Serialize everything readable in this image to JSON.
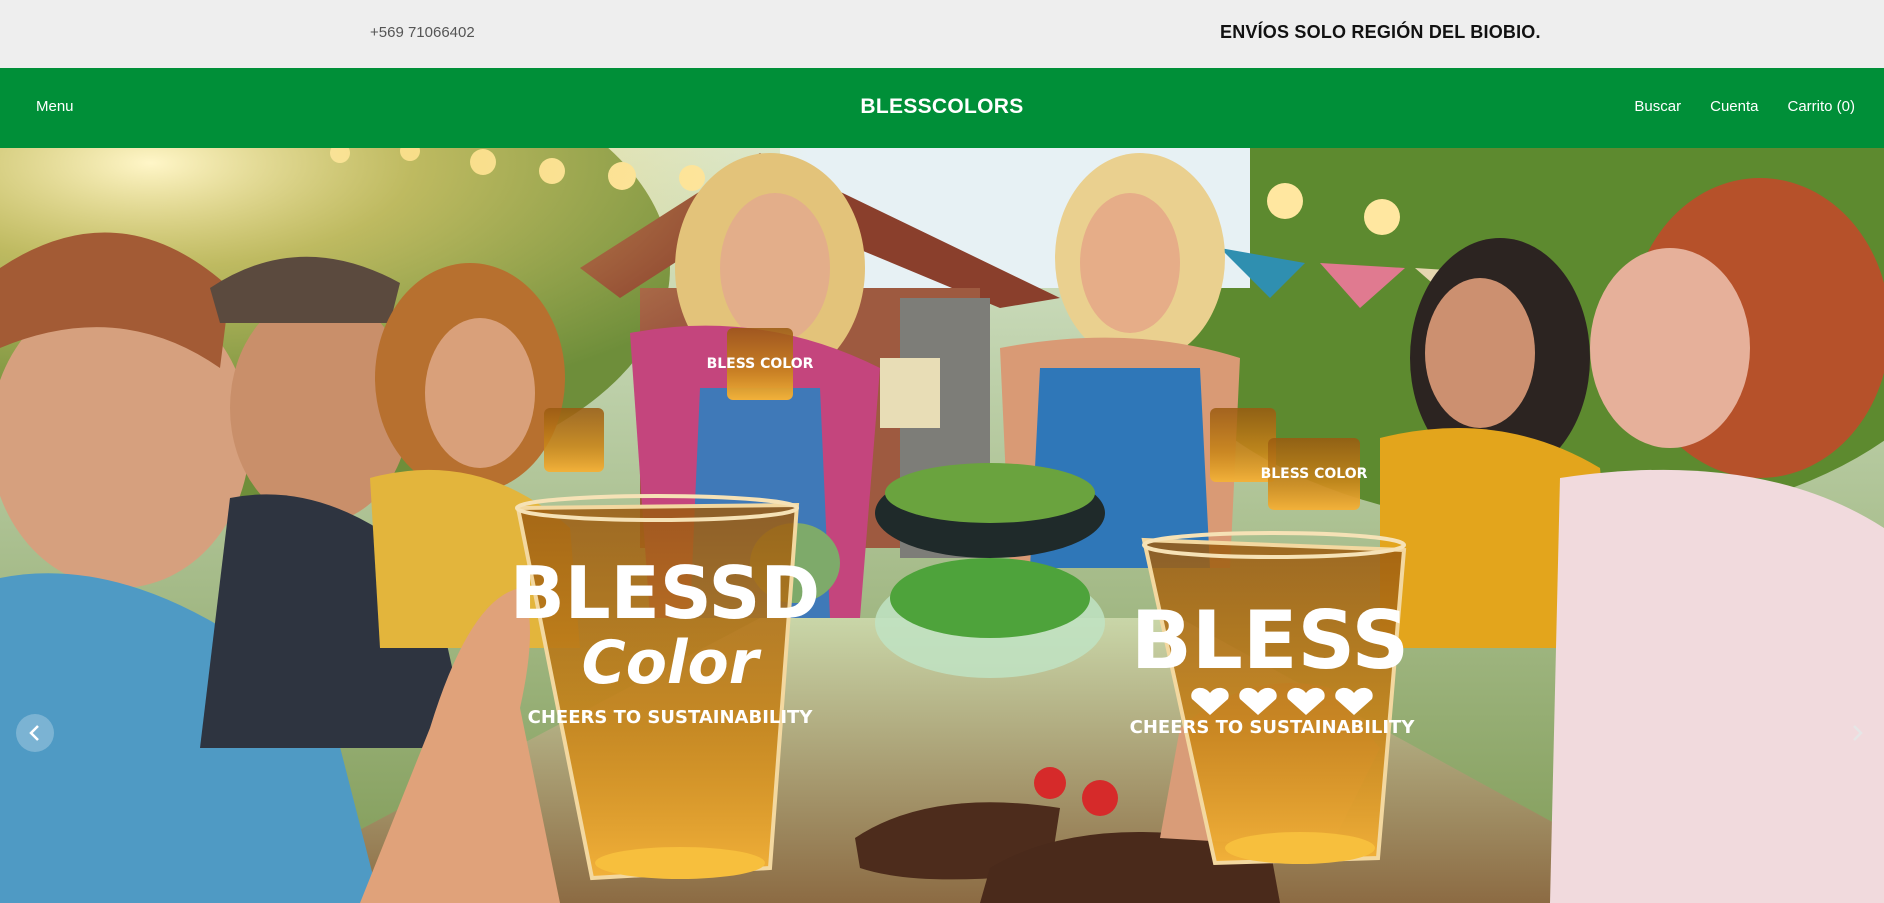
{
  "topbar": {
    "phone": "+569 71066402",
    "notice": "ENVÍOS SOLO REGIÓN DEL BIOBIO."
  },
  "navbar": {
    "menu_label": "Menu",
    "brand": "BLESSCOLORS",
    "search_label": "Buscar",
    "account_label": "Cuenta",
    "cart_label": "Carrito (0)"
  },
  "hero": {
    "image_description": "Group of friends toasting with amber BLESS COLOR cups at an outdoor barbecue",
    "cup_left_line1": "BLESSD",
    "cup_left_line2": "Color",
    "cup_left_line3": "CHEERS TO SUSTAINABILITY",
    "cup_right_line1": "BLESS",
    "cup_right_line3": "CHEERS TO SUSTAINABILITY",
    "small_cup_text": "BLESS COLOR"
  },
  "carousel": {
    "prev_icon": "chevron-left-icon",
    "next_icon": "chevron-right-icon"
  },
  "colors": {
    "nav_green": "#008f38",
    "topbar_gray": "#eeeeee",
    "amber_cup": "#c8860f"
  }
}
